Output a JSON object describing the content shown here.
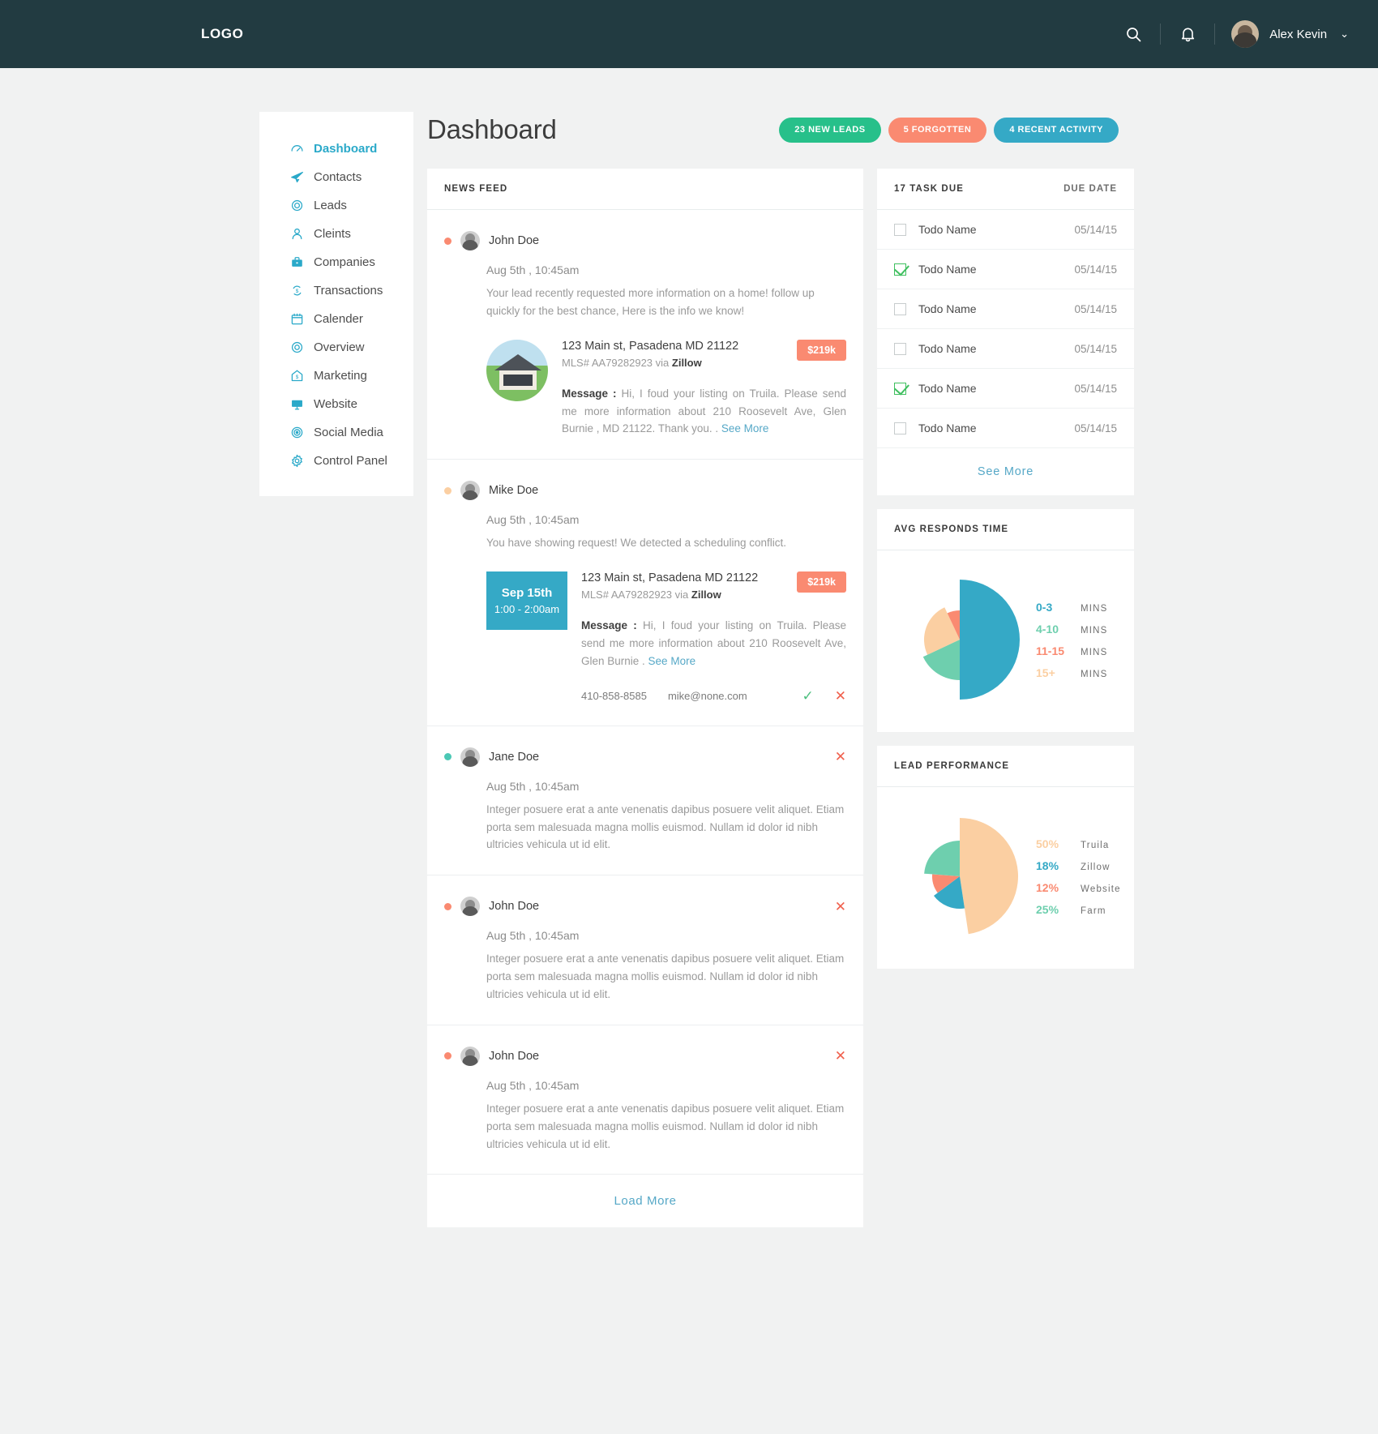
{
  "header": {
    "logo": "LOGO",
    "search_icon": "search-icon",
    "bell_icon": "notification-bell-icon",
    "username": "Alex Kevin",
    "caret": "⌄"
  },
  "sidebar": {
    "items": [
      {
        "label": "Dashboard",
        "icon": "speedometer-icon",
        "active": true
      },
      {
        "label": "Contacts",
        "icon": "paper-plane-icon",
        "active": false
      },
      {
        "label": "Leads",
        "icon": "target-icon",
        "active": false
      },
      {
        "label": "Cleints",
        "icon": "person-icon",
        "active": false
      },
      {
        "label": "Companies",
        "icon": "briefcase-icon",
        "active": false
      },
      {
        "label": "Transactions",
        "icon": "dollar-swap-icon",
        "active": false
      },
      {
        "label": "Calender",
        "icon": "calendar-icon",
        "active": false
      },
      {
        "label": "Overview",
        "icon": "circle-ring-icon",
        "active": false
      },
      {
        "label": "Marketing",
        "icon": "house-dollar-icon",
        "active": false
      },
      {
        "label": "Website",
        "icon": "monitor-icon",
        "active": false
      },
      {
        "label": "Social Media",
        "icon": "target-ring-icon",
        "active": false
      },
      {
        "label": "Control Panel",
        "icon": "gear-icon",
        "active": false
      }
    ]
  },
  "main": {
    "title": "Dashboard",
    "badges": [
      {
        "label": "23 NEW LEADS",
        "color": "#27c08a"
      },
      {
        "label": "5 FORGOTTEN",
        "color": "#fa8a71"
      },
      {
        "label": "4 RECENT ACTIVITY",
        "color": "#35a9c6"
      }
    ]
  },
  "feed": {
    "heading": "NEWS FEED",
    "load_more": "Load More",
    "posts": [
      {
        "name": "John Doe",
        "dot": "#fa8a71",
        "time": "Aug 5th ,  10:45am",
        "text": "Your lead recently requested more information on a home! follow up quickly for the best chance, Here is the info we know!",
        "has_close": false,
        "listing": {
          "media": "house-photo",
          "address": "123 Main st, Pasadena MD 21122",
          "mls_prefix": "MLS# AA79282923 via ",
          "source": "Zillow",
          "price": "$219k",
          "message_label": "Message :",
          "message": " Hi,  I foud your listing on Truila. Please send me more information about 210 Roosevelt Ave, Glen Burnie , MD 21122. Thank you. . ",
          "see_more": "See More"
        }
      },
      {
        "name": "Mike Doe",
        "dot": "#fbcfa2",
        "time": "Aug 5th ,  10:45am",
        "text": "You have showing request! We detected a scheduling conflict.",
        "has_close": false,
        "listing": {
          "media": "date-block",
          "date_day": "Sep 15th",
          "date_time": "1:00 - 2:00am",
          "address": "123 Main st, Pasadena MD 21122",
          "mls_prefix": "MLS# AA79282923 via ",
          "source": "Zillow",
          "price": "$219k",
          "message_label": "Message :",
          "message": " Hi,  I foud your listing on Truila. Please send me more information about 210 Roosevelt Ave, Glen Burnie  . ",
          "see_more": "See More",
          "phone": "410-858-8585",
          "email": "mike@none.com",
          "accept_icon": "checkmark-icon",
          "reject_icon": "x-icon"
        }
      },
      {
        "name": "Jane Doe",
        "dot": "#4bc8b5",
        "time": "Aug 5th ,  10:45am",
        "text": "Integer posuere erat a ante venenatis dapibus posuere velit aliquet. Etiam porta sem malesuada magna mollis euismod. Nullam id dolor id nibh ultricies vehicula ut id elit.",
        "has_close": true
      },
      {
        "name": "John Doe",
        "dot": "#fa8a71",
        "time": "Aug 5th ,  10:45am",
        "text": "Integer posuere erat a ante venenatis dapibus posuere velit aliquet. Etiam porta sem malesuada magna mollis euismod. Nullam id dolor id nibh ultricies vehicula ut id elit.",
        "has_close": true
      },
      {
        "name": "John Doe",
        "dot": "#fa8a71",
        "time": "Aug 5th ,  10:45am",
        "text": "Integer posuere erat a ante venenatis dapibus posuere velit aliquet. Etiam porta sem malesuada magna mollis euismod. Nullam id dolor id nibh ultricies vehicula ut id elit.",
        "has_close": true
      }
    ]
  },
  "tasks": {
    "heading": "17 TASK DUE",
    "due_heading": "DUE DATE",
    "see_more": "See More",
    "rows": [
      {
        "label": "Todo Name",
        "date": "05/14/15",
        "checked": false
      },
      {
        "label": "Todo Name",
        "date": "05/14/15",
        "checked": true
      },
      {
        "label": "Todo Name",
        "date": "05/14/15",
        "checked": false
      },
      {
        "label": "Todo Name",
        "date": "05/14/15",
        "checked": false
      },
      {
        "label": "Todo Name",
        "date": "05/14/15",
        "checked": true
      },
      {
        "label": "Todo Name",
        "date": "05/14/15",
        "checked": false
      }
    ]
  },
  "chart_data": [
    {
      "type": "pie",
      "title": "AVG RESPONDS TIME",
      "categories": [
        "0-3",
        "4-10",
        "11-15",
        "15+"
      ],
      "unit": "MINS",
      "values": [
        50,
        18,
        25,
        7
      ],
      "colors": [
        "#35a9c6",
        "#6ecfae",
        "#fbcfa2",
        "#fa8a71"
      ],
      "legend": [
        {
          "value": "0-3",
          "unit": "MINS",
          "color": "#35a9c6"
        },
        {
          "value": "4-10",
          "unit": "MINS",
          "color": "#6ecfae"
        },
        {
          "value": "11-15",
          "unit": "MINS",
          "color": "#fa8a71"
        },
        {
          "value": "15+",
          "unit": "MINS",
          "color": "#fbcfa2"
        }
      ],
      "legend_position": "right"
    },
    {
      "type": "pie",
      "title": "LEAD PERFORMANCE",
      "categories": [
        "Truila",
        "Zillow",
        "Website",
        "Farm"
      ],
      "values": [
        50,
        18,
        12,
        25
      ],
      "colors": [
        "#fbcfa2",
        "#35a9c6",
        "#fa8a71",
        "#6ecfae"
      ],
      "legend": [
        {
          "value": "50%",
          "unit": "Truila",
          "color": "#fbcfa2"
        },
        {
          "value": "18%",
          "unit": "Zillow",
          "color": "#35a9c6"
        },
        {
          "value": "12%",
          "unit": "Website",
          "color": "#fa8a71"
        },
        {
          "value": "25%",
          "unit": "Farm",
          "color": "#6ecfae"
        }
      ],
      "legend_position": "right"
    }
  ]
}
